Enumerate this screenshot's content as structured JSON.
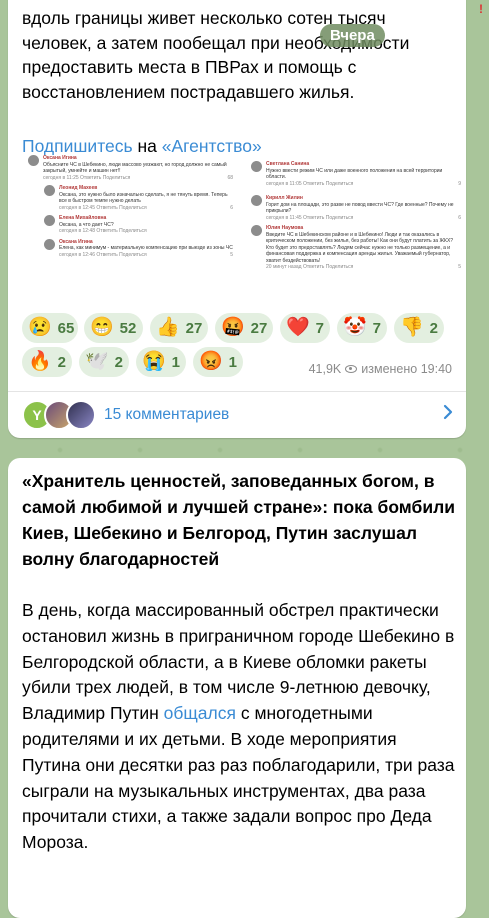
{
  "message1": {
    "text_top": "вдоль границы живет несколько сотен тысяч человек, а затем пообещал при необходимости предоставить места в ПВРах и помощь с восстановлением пострадавшего жилья.",
    "date_pill": "Вчера",
    "subscribe_prefix": "Подпишитесь",
    "subscribe_mid": " на ",
    "subscribe_link": "«Агентство»",
    "embed": {
      "left": [
        {
          "name": "Оксана Игина",
          "text": "Объясните ЧС в Шебекино, люди массово уезжают, но город должно не самый закрытый, умнейте и машин нет!!",
          "meta": "сегодня в 11:25  Ответить  Поделиться",
          "likes": "68"
        },
        {
          "name": "Леонид Махеев",
          "text": "Оксана, это нужно было изначально сделать, я не тянуть время. Теперь все в быстром темпе нужно делать",
          "meta": "сегодня в 12:45  Ответить  Поделиться",
          "likes": "6"
        },
        {
          "name": "Елена Михайловна",
          "text": "Оксана, а что дает ЧС?",
          "meta": "сегодня в 12:48  Ответить  Поделиться",
          "likes": ""
        },
        {
          "name": "Оксана Игина",
          "text": "Елена, как минимум - материальную компенсацию при выезде из зоны ЧС",
          "meta": "сегодня в 12:46  Ответить  Поделиться",
          "likes": "5"
        }
      ],
      "right": [
        {
          "name": "Светлана Санина",
          "text": "Нужно ввести режим ЧС или даже военного положения на всей территории области.",
          "meta": "сегодня в 11:05  Ответить  Поделиться",
          "likes": "9"
        },
        {
          "name": "Кирилл Жилин",
          "text": "Горит дом на площади, это разве не повод ввести ЧС? Где военные? Почему не прикрыли?",
          "meta": "сегодня в 11:45  Ответить  Поделиться",
          "likes": "6"
        },
        {
          "name": "Юлия Наумова",
          "text": "Введите ЧС в Шебекинском районе и в Шебекино! Люди и так оказались в критическом положении, без жилья, без работы! Как они будут платить за ЖКХ? Кто будет это предоставлять? Людям сейчас нужно не только размещение, а и финансовая поддержка и компенсация аренды жилья. Уважаемый губернатор, хватит бездействовать!",
          "meta": "20 минут назад  Ответить  Поделиться",
          "likes": "5"
        }
      ]
    },
    "reactions": [
      {
        "icon": "crying-face-icon",
        "glyph": "😢",
        "count": "65"
      },
      {
        "icon": "grinning-face-icon",
        "glyph": "😁",
        "count": "52"
      },
      {
        "icon": "thumbs-up-icon",
        "glyph": "👍",
        "count": "27"
      },
      {
        "icon": "angry-cursing-face-icon",
        "glyph": "🤬",
        "count": "27"
      },
      {
        "icon": "red-heart-icon",
        "glyph": "❤️",
        "count": "7"
      },
      {
        "icon": "clown-face-icon",
        "glyph": "🤡",
        "count": "7"
      },
      {
        "icon": "thumbs-down-icon",
        "glyph": "👎",
        "count": "2"
      },
      {
        "icon": "fire-icon",
        "glyph": "🔥",
        "count": "2"
      },
      {
        "icon": "dove-icon",
        "glyph": "🕊️",
        "count": "2"
      },
      {
        "icon": "loudly-crying-face-icon",
        "glyph": "😭",
        "count": "1"
      },
      {
        "icon": "angry-face-icon",
        "glyph": "😡",
        "count": "1"
      }
    ],
    "views": "41,9K",
    "edited_time": "изменено 19:40",
    "comments_label": "15 комментариев",
    "comment_avatar_letter": "Y"
  },
  "message2": {
    "title": "«Хранитель ценностей, заповеданных богом, в самой любимой и лучшей стране»: пока бомбили Киев, Шебекино и Белгород, Путин заслушал волну благодарностей",
    "body_part1": "В день, когда массированный обстрел практически остановил жизнь в приграничном городе Шебекино в Белгородской области, а в Киеве обломки ракеты убили трех людей, в том числе 9-летнюю девочку, Владимир Путин ",
    "body_link": "общался",
    "body_part2": " с многодетными родителями и их детьми. В ходе мероприятия Путина они десятки раз раз поблагодарили, три раза сыграли на музыкальных инструментах, два раза прочитали стихи, а также задали вопрос про Деда Мороза."
  },
  "colors": {
    "link": "#3a8bd4",
    "reaction_bg": "#e3efe0",
    "reaction_text": "#4a7b41",
    "background": "#a9c59a"
  }
}
